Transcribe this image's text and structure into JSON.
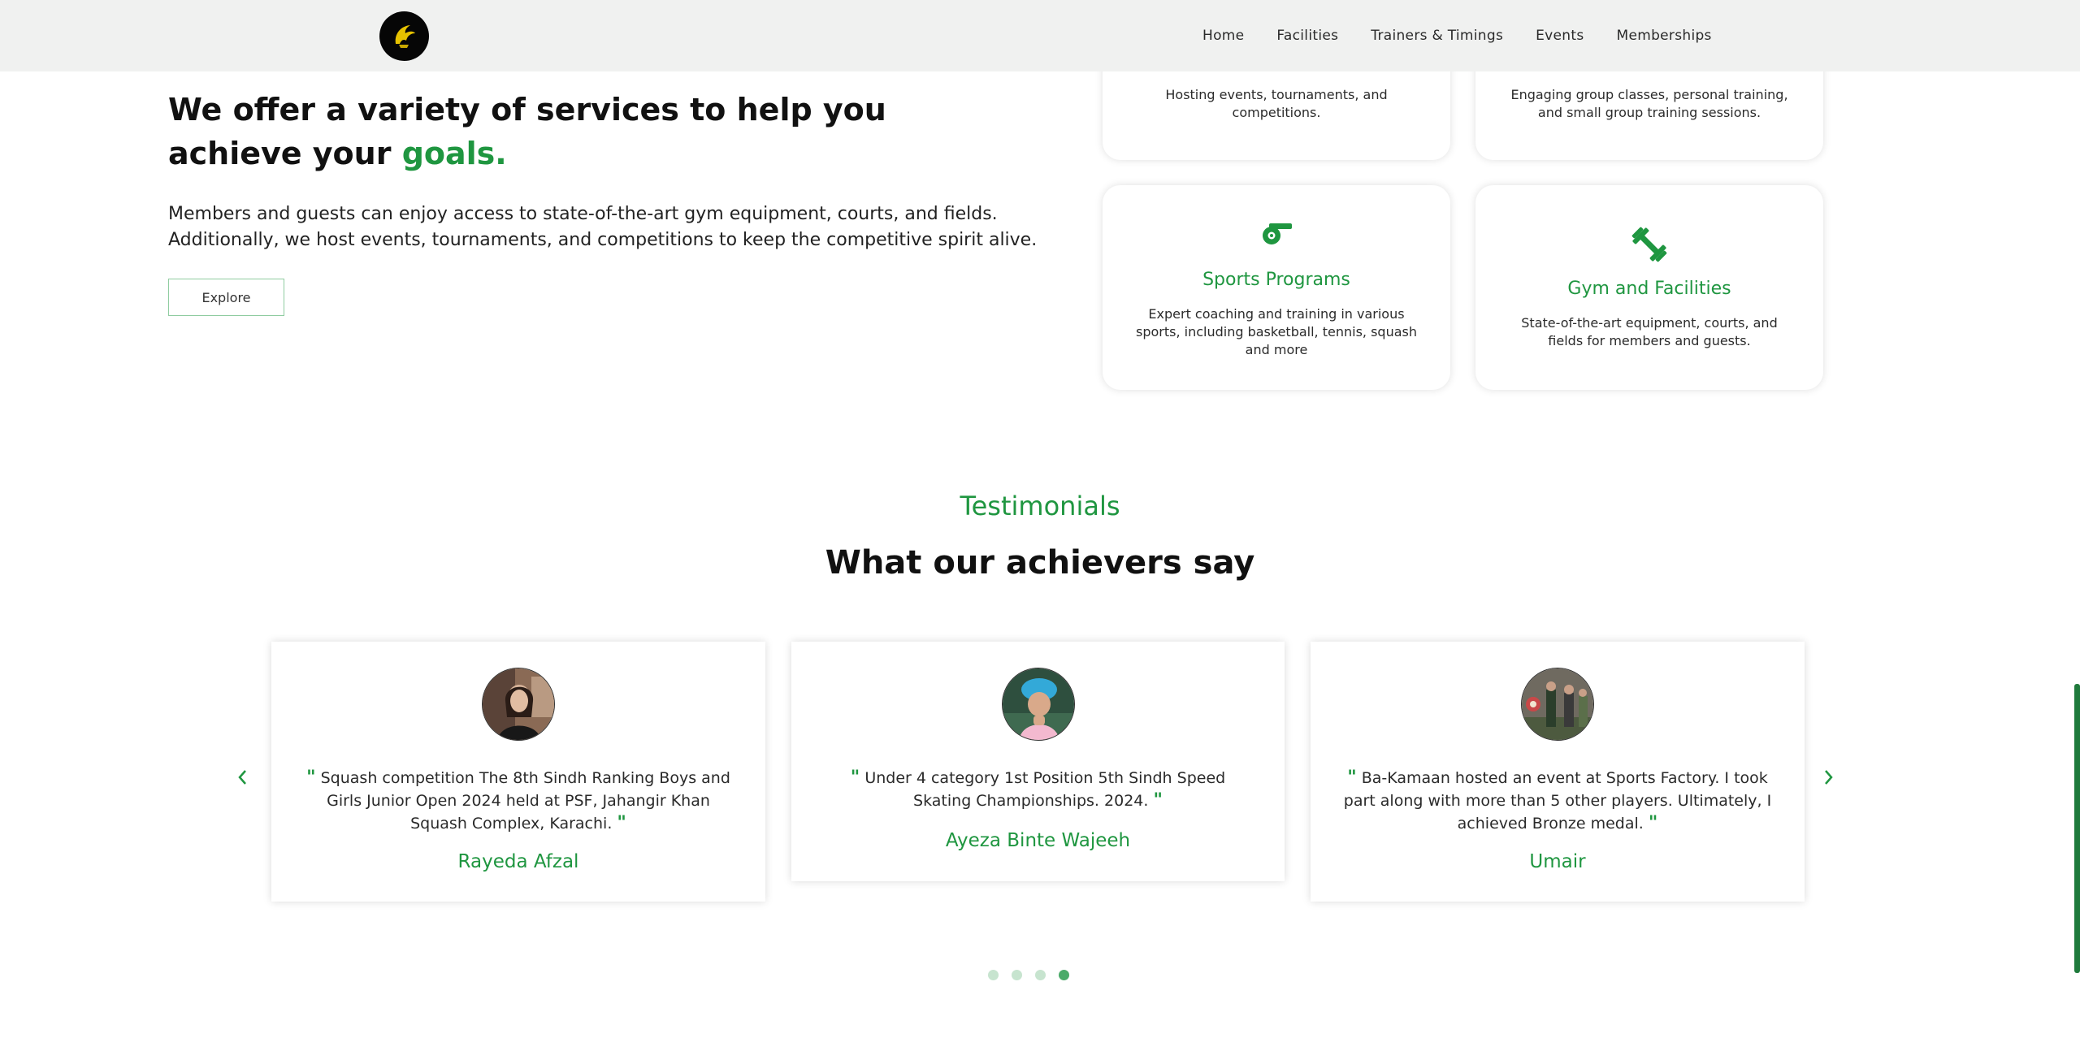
{
  "nav": {
    "logo_icon": "eagle-logo",
    "links": [
      "Home",
      "Facilities",
      "Trainers & Timings",
      "Events",
      "Memberships"
    ]
  },
  "hero": {
    "title_main": "We offer a variety of services to help you achieve your",
    "title_accent": "goals.",
    "description": "Members and guests can enjoy access to state-of-the-art gym equipment, courts, and fields. Additionally, we host events, tournaments, and competitions to keep the competitive spirit alive.",
    "button": "Explore"
  },
  "services": [
    {
      "title": "",
      "text": "Hosting events, tournaments, and competitions."
    },
    {
      "title": "",
      "text": "Engaging group classes, personal training, and small group training sessions."
    },
    {
      "icon": "whistle-icon",
      "title": "Sports Programs",
      "text": "Expert coaching and training in various sports, including basketball, tennis, squash and more"
    },
    {
      "icon": "dumbbell-icon",
      "title": "Gym and Facilities",
      "text": "State-of-the-art equipment, courts, and fields for members and guests."
    }
  ],
  "testimonials": {
    "kicker": "Testimonials",
    "heading": "What our achievers say",
    "quote_mark": "\"",
    "items": [
      {
        "quote": "Squash competition The 8th Sindh Ranking Boys and Girls Junior Open 2024 held at PSF, Jahangir Khan Squash Complex, Karachi.",
        "name": "Rayeda Afzal"
      },
      {
        "quote": "Under 4 category 1st Position 5th Sindh Speed Skating Championships. 2024.",
        "name": "Ayeza Binte Wajeeh"
      },
      {
        "quote": "Ba-Kamaan hosted an event at Sports Factory. I took part along with more than 5 other players. Ultimately, I achieved Bronze medal.",
        "name": "Umair"
      }
    ],
    "carousel": {
      "total_slides": 4,
      "active_slide": 4
    }
  },
  "colors": {
    "accent": "#1f9640",
    "nav_bg": "#f0f1f0",
    "dot_inactive": "#c7e4cf",
    "dot_active": "#4aab69"
  }
}
